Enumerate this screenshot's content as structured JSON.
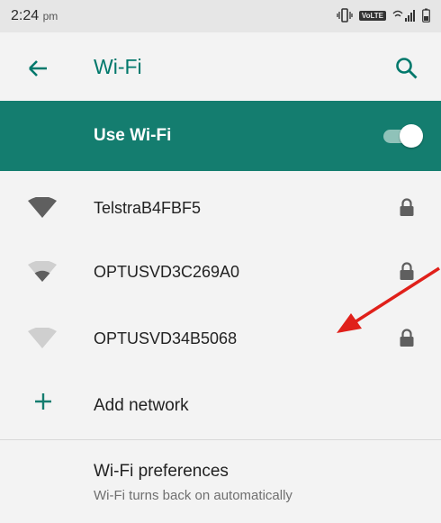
{
  "status_bar": {
    "time": "2:24",
    "ampm": "pm",
    "volte_label": "VoLTE"
  },
  "app_bar": {
    "title": "Wi-Fi",
    "back_icon": "arrow-back-icon",
    "search_icon": "search-icon"
  },
  "master_switch": {
    "label": "Use Wi-Fi",
    "checked": true
  },
  "colors": {
    "accent": "#147d6f",
    "title": "#00786b",
    "arrow": "#e0201a"
  },
  "networks": [
    {
      "name": "TelstraB4FBF5",
      "signal_level": 4,
      "secured": true
    },
    {
      "name": "OPTUSVD3C269A0",
      "signal_level": 2,
      "secured": true
    },
    {
      "name": "OPTUSVD34B5068",
      "signal_level": 0,
      "secured": true
    }
  ],
  "add_network": {
    "label": "Add network"
  },
  "preferences": {
    "title": "Wi-Fi preferences",
    "subtitle": "Wi-Fi turns back on automatically"
  }
}
